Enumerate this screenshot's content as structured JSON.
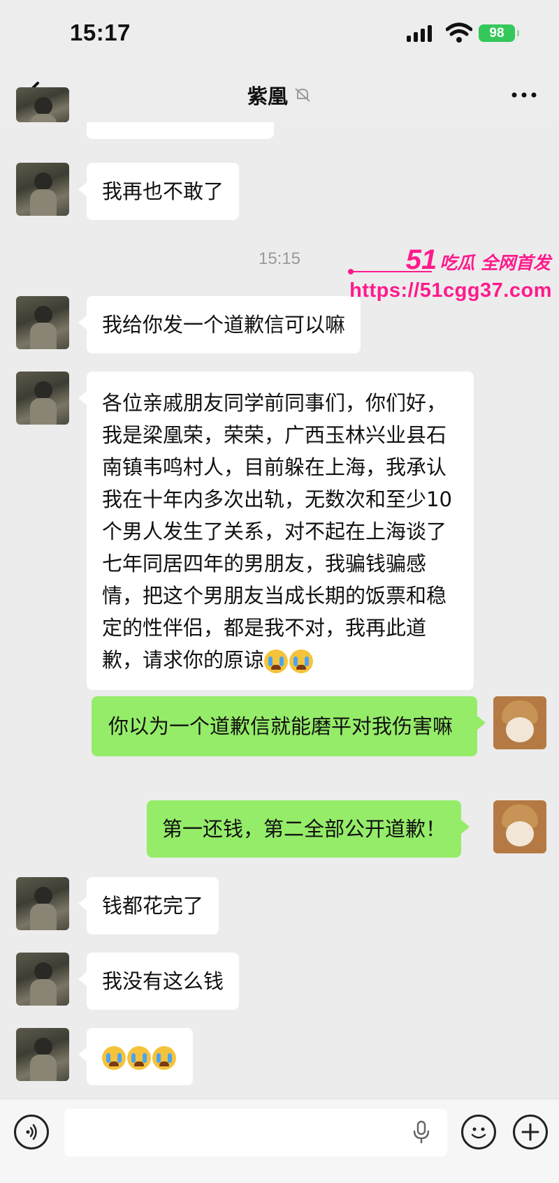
{
  "status_bar": {
    "time": "15:17",
    "battery": "98"
  },
  "header": {
    "title": "紫凰",
    "muted_icon": "bell-off-icon"
  },
  "watermark": {
    "brand": "51",
    "tagline": "吃瓜 全网首发",
    "url": "https://51cgg37.com"
  },
  "timestamp": "15:15",
  "messages": [
    {
      "from": "her",
      "text": "我再也不敢了"
    },
    {
      "from": "her",
      "text": "我给你发一个道歉信可以嘛"
    },
    {
      "from": "her",
      "text": "各位亲戚朋友同学前同事们，你们好，我是梁凰荣，荣荣，广西玉林兴业县石南镇韦鸣村人，目前躲在上海，我承认我在十年内多次出轨，无数次和至少10个男人发生了关系，对不起在上海谈了七年同居四年的男朋友，我骗钱骗感情，把这个男朋友当成长期的饭票和稳定的性伴侣，都是我不对，我再此道歉，请求你的原谅",
      "emoji": "loudly-crying-face x2"
    },
    {
      "from": "me",
      "text": "你以为一个道歉信就能磨平对我伤害嘛"
    },
    {
      "from": "me",
      "text": "第一还钱，第二全部公开道歉！"
    },
    {
      "from": "her",
      "text": "钱都花完了"
    },
    {
      "from": "her",
      "text": "我没有这么钱"
    },
    {
      "from": "her",
      "text": "",
      "emoji": "loudly-crying-face x3"
    }
  ],
  "input_bar": {
    "placeholder": ""
  },
  "colors": {
    "outgoing_bubble": "#95ec69",
    "incoming_bubble": "#ffffff",
    "watermark": "#ff1a8c"
  }
}
